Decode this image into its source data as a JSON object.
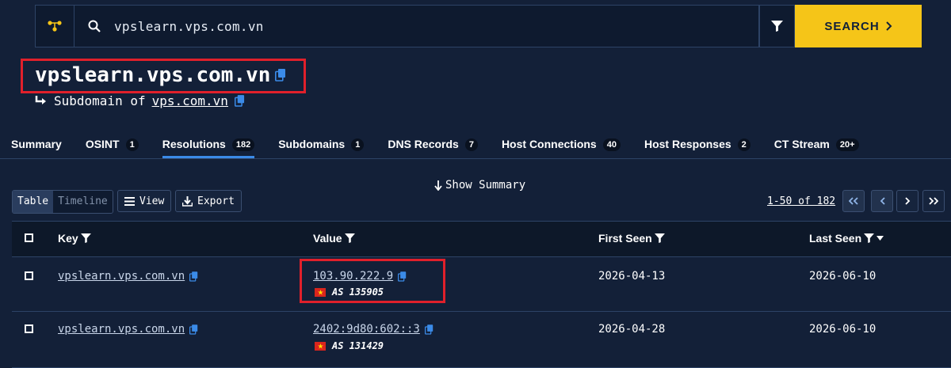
{
  "search": {
    "query": "vpslearn.vps.com.vn",
    "button_label": "SEARCH"
  },
  "entity": {
    "name": "vpslearn.vps.com.vn",
    "relation_label": "Subdomain of",
    "parent_domain": "vps.com.vn"
  },
  "tabs": [
    {
      "label": "Summary",
      "count": ""
    },
    {
      "label": "OSINT",
      "count": "1"
    },
    {
      "label": "Resolutions",
      "count": "182"
    },
    {
      "label": "Subdomains",
      "count": "1"
    },
    {
      "label": "DNS Records",
      "count": "7"
    },
    {
      "label": "Host Connections",
      "count": "40"
    },
    {
      "label": "Host Responses",
      "count": "2"
    },
    {
      "label": "CT Stream",
      "count": "20+"
    }
  ],
  "active_tab": "Resolutions",
  "toolbar": {
    "show_summary": "Show Summary",
    "view_table": "Table",
    "view_timeline": "Timeline",
    "view_button": "View",
    "export_button": "Export",
    "pagination": "1-50 of 182"
  },
  "table": {
    "columns": [
      "Key",
      "Value",
      "First Seen",
      "Last Seen"
    ],
    "rows": [
      {
        "key": "vpslearn.vps.com.vn",
        "value": "103.90.222.9",
        "asn": "AS 135905",
        "first_seen": "2026-04-13",
        "last_seen": "2026-06-10"
      },
      {
        "key": "vpslearn.vps.com.vn",
        "value": "2402:9d80:602::3",
        "asn": "AS 131429",
        "first_seen": "2026-04-28",
        "last_seen": "2026-06-10"
      }
    ]
  },
  "colors": {
    "background": "#132038",
    "accent_yellow": "#f5c518",
    "link_blue": "#3b8be8",
    "highlight_red": "#e0202b"
  }
}
